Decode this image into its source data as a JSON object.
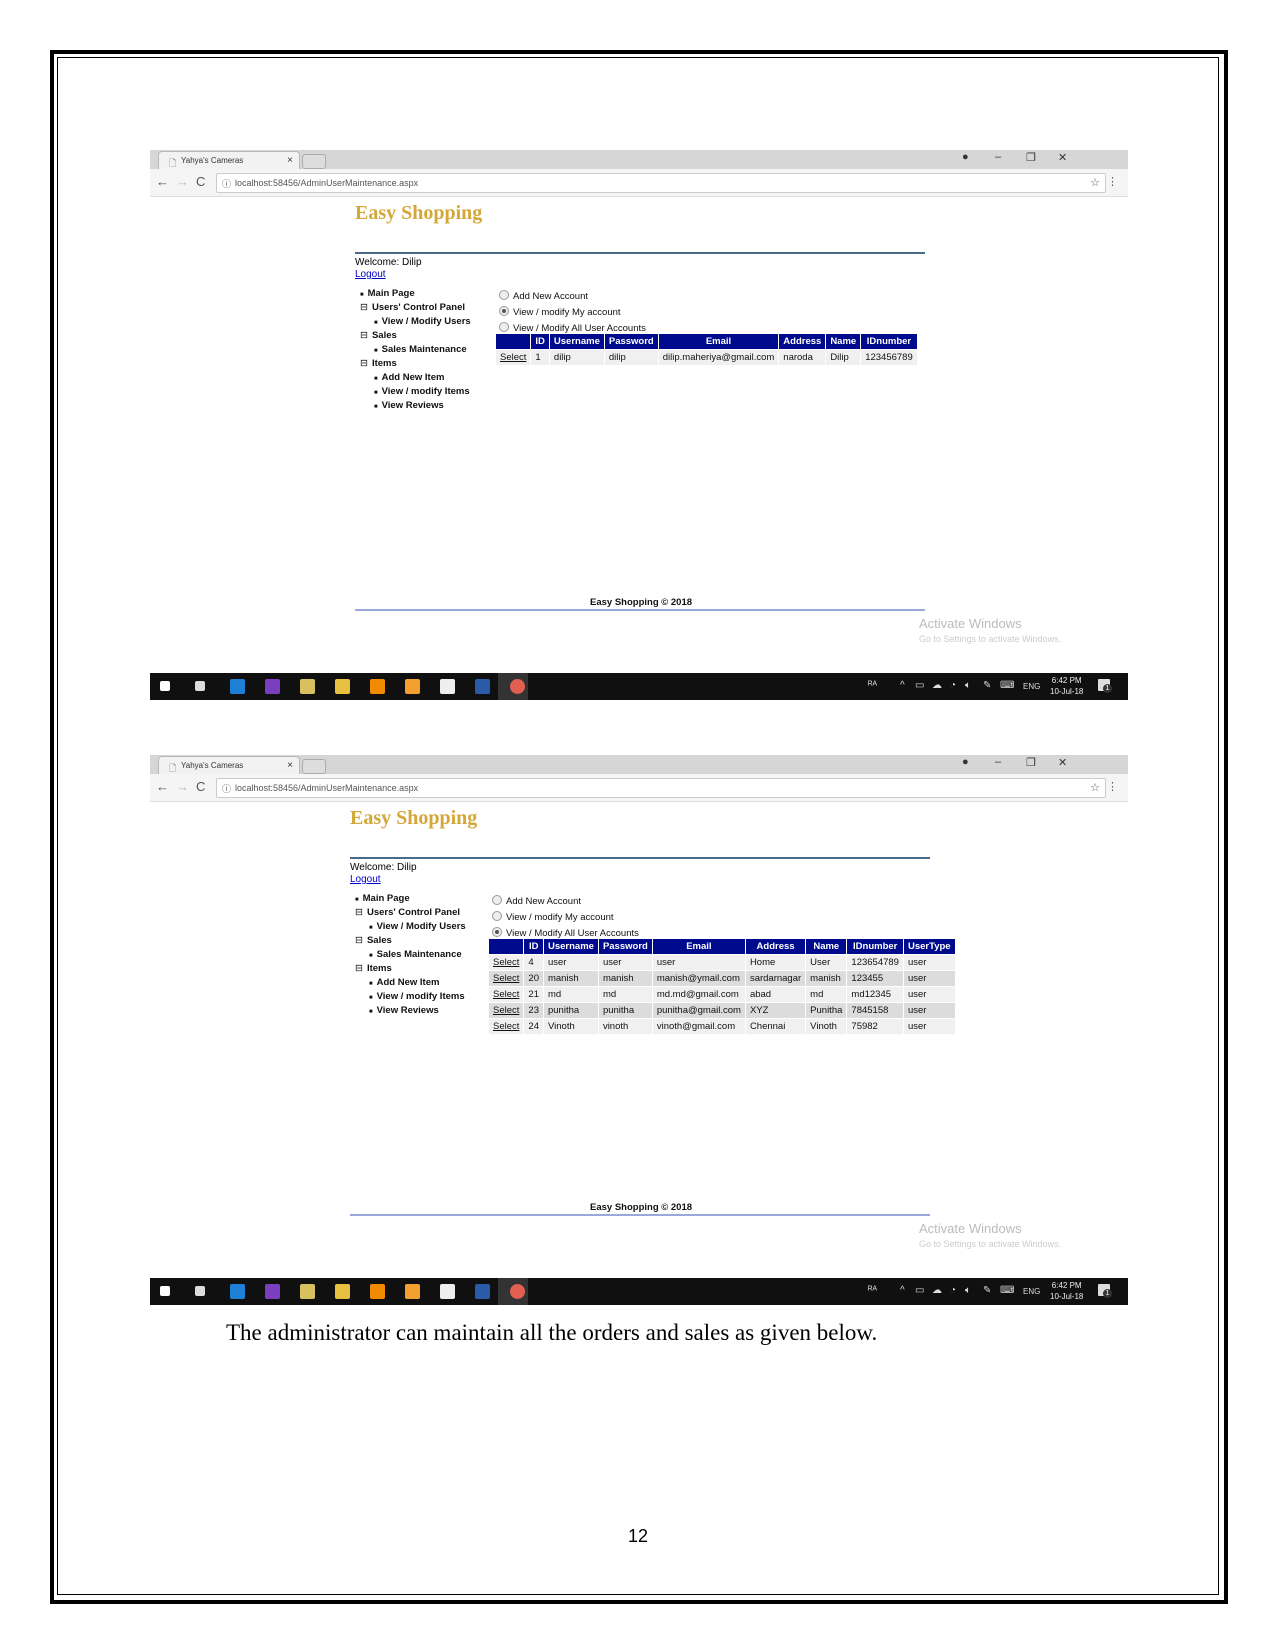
{
  "screenshots": [
    {
      "browser": {
        "tab_title": "Yahya's Cameras",
        "url": "localhost:58456/AdminUserMaintenance.aspx"
      },
      "site_title": "Easy Shopping",
      "welcome": "Welcome: Dilip",
      "logout": "Logout",
      "menu": [
        {
          "label": "Main Page",
          "level": 0,
          "marker": "bullet"
        },
        {
          "label": "Users' Control Panel",
          "level": 0,
          "marker": "collapse"
        },
        {
          "label": "View / Modify Users",
          "level": 1,
          "marker": "bullet"
        },
        {
          "label": "Sales",
          "level": 0,
          "marker": "collapse"
        },
        {
          "label": "Sales Maintenance",
          "level": 1,
          "marker": "bullet"
        },
        {
          "label": "Items",
          "level": 0,
          "marker": "collapse"
        },
        {
          "label": "Add New Item",
          "level": 1,
          "marker": "bullet"
        },
        {
          "label": "View / modify Items",
          "level": 1,
          "marker": "bullet"
        },
        {
          "label": "View Reviews",
          "level": 1,
          "marker": "bullet"
        }
      ],
      "radios": [
        {
          "label": "Add New Account",
          "checked": false
        },
        {
          "label": "View / modify My account",
          "checked": true
        },
        {
          "label": "View / Modify All User Accounts",
          "checked": false
        }
      ],
      "table": {
        "columns": [
          "",
          "ID",
          "Username",
          "Password",
          "Email",
          "Address",
          "Name",
          "IDnumber"
        ],
        "rows": [
          [
            "Select",
            "1",
            "dilip",
            "dilip",
            "dilip.maheriya@gmail.com",
            "naroda",
            "Dilip",
            "123456789"
          ]
        ]
      },
      "footer": "Easy Shopping © 2018",
      "watermark": {
        "title": "Activate Windows",
        "subtitle": "Go to Settings to activate Windows."
      },
      "taskbar": {
        "language": "ENG",
        "time": "6:42 PM",
        "date": "10-Jul-18",
        "notifications": "1"
      }
    },
    {
      "browser": {
        "tab_title": "Yahya's Cameras",
        "url": "localhost:58456/AdminUserMaintenance.aspx"
      },
      "site_title": "Easy Shopping",
      "welcome": "Welcome: Dilip",
      "logout": "Logout",
      "menu": [
        {
          "label": "Main Page",
          "level": 0,
          "marker": "bullet"
        },
        {
          "label": "Users' Control Panel",
          "level": 0,
          "marker": "collapse"
        },
        {
          "label": "View / Modify Users",
          "level": 1,
          "marker": "bullet"
        },
        {
          "label": "Sales",
          "level": 0,
          "marker": "collapse"
        },
        {
          "label": "Sales Maintenance",
          "level": 1,
          "marker": "bullet"
        },
        {
          "label": "Items",
          "level": 0,
          "marker": "collapse"
        },
        {
          "label": "Add New Item",
          "level": 1,
          "marker": "bullet"
        },
        {
          "label": "View / modify Items",
          "level": 1,
          "marker": "bullet"
        },
        {
          "label": "View Reviews",
          "level": 1,
          "marker": "bullet"
        }
      ],
      "radios": [
        {
          "label": "Add New Account",
          "checked": false
        },
        {
          "label": "View / modify My account",
          "checked": false
        },
        {
          "label": "View / Modify All User Accounts",
          "checked": true
        }
      ],
      "table": {
        "columns": [
          "",
          "ID",
          "Username",
          "Password",
          "Email",
          "Address",
          "Name",
          "IDnumber",
          "UserType"
        ],
        "rows": [
          [
            "Select",
            "4",
            "user",
            "user",
            "user",
            "Home",
            "User",
            "123654789",
            "user"
          ],
          [
            "Select",
            "20",
            "manish",
            "manish",
            "manish@ymail.com",
            "sardarnagar",
            "manish",
            "123455",
            "user"
          ],
          [
            "Select",
            "21",
            "md",
            "md",
            "md.md@gmail.com",
            "abad",
            "md",
            "md12345",
            "user"
          ],
          [
            "Select",
            "23",
            "punitha",
            "punitha",
            "punitha@gmail.com",
            "XYZ",
            "Punitha",
            "7845158",
            "user"
          ],
          [
            "Select",
            "24",
            "Vinoth",
            "vinoth",
            "vinoth@gmail.com",
            "Chennai",
            "Vinoth",
            "75982",
            "user"
          ]
        ]
      },
      "footer": "Easy Shopping © 2018",
      "watermark": {
        "title": "Activate Windows",
        "subtitle": "Go to Settings to activate Windows."
      },
      "taskbar": {
        "language": "ENG",
        "time": "6:42 PM",
        "date": "10-Jul-18",
        "notifications": "1"
      }
    }
  ],
  "taskbar_icons": [
    {
      "name": "windows-start-icon",
      "color": "#ffffff"
    },
    {
      "name": "task-view-icon",
      "color": "#dddddd"
    },
    {
      "name": "edge-browser-icon",
      "color": "#1e7fd6"
    },
    {
      "name": "visual-studio-icon",
      "color": "#7a3fbf"
    },
    {
      "name": "tools-icon",
      "color": "#d8c060"
    },
    {
      "name": "file-explorer-icon",
      "color": "#e8c040"
    },
    {
      "name": "vlc-icon",
      "color": "#f08a00"
    },
    {
      "name": "app-icon",
      "color": "#f4a030"
    },
    {
      "name": "mail-icon",
      "color": "#eeeeee"
    },
    {
      "name": "word-icon",
      "color": "#2b5aa8"
    },
    {
      "name": "chrome-icon",
      "color": "#dd4433"
    }
  ],
  "colors": {
    "site_title": "#d4a838",
    "table_header": "#000a8c",
    "link": "#0000cc"
  },
  "caption": "The administrator can maintain all the orders and sales as given below.",
  "page_number": "12"
}
